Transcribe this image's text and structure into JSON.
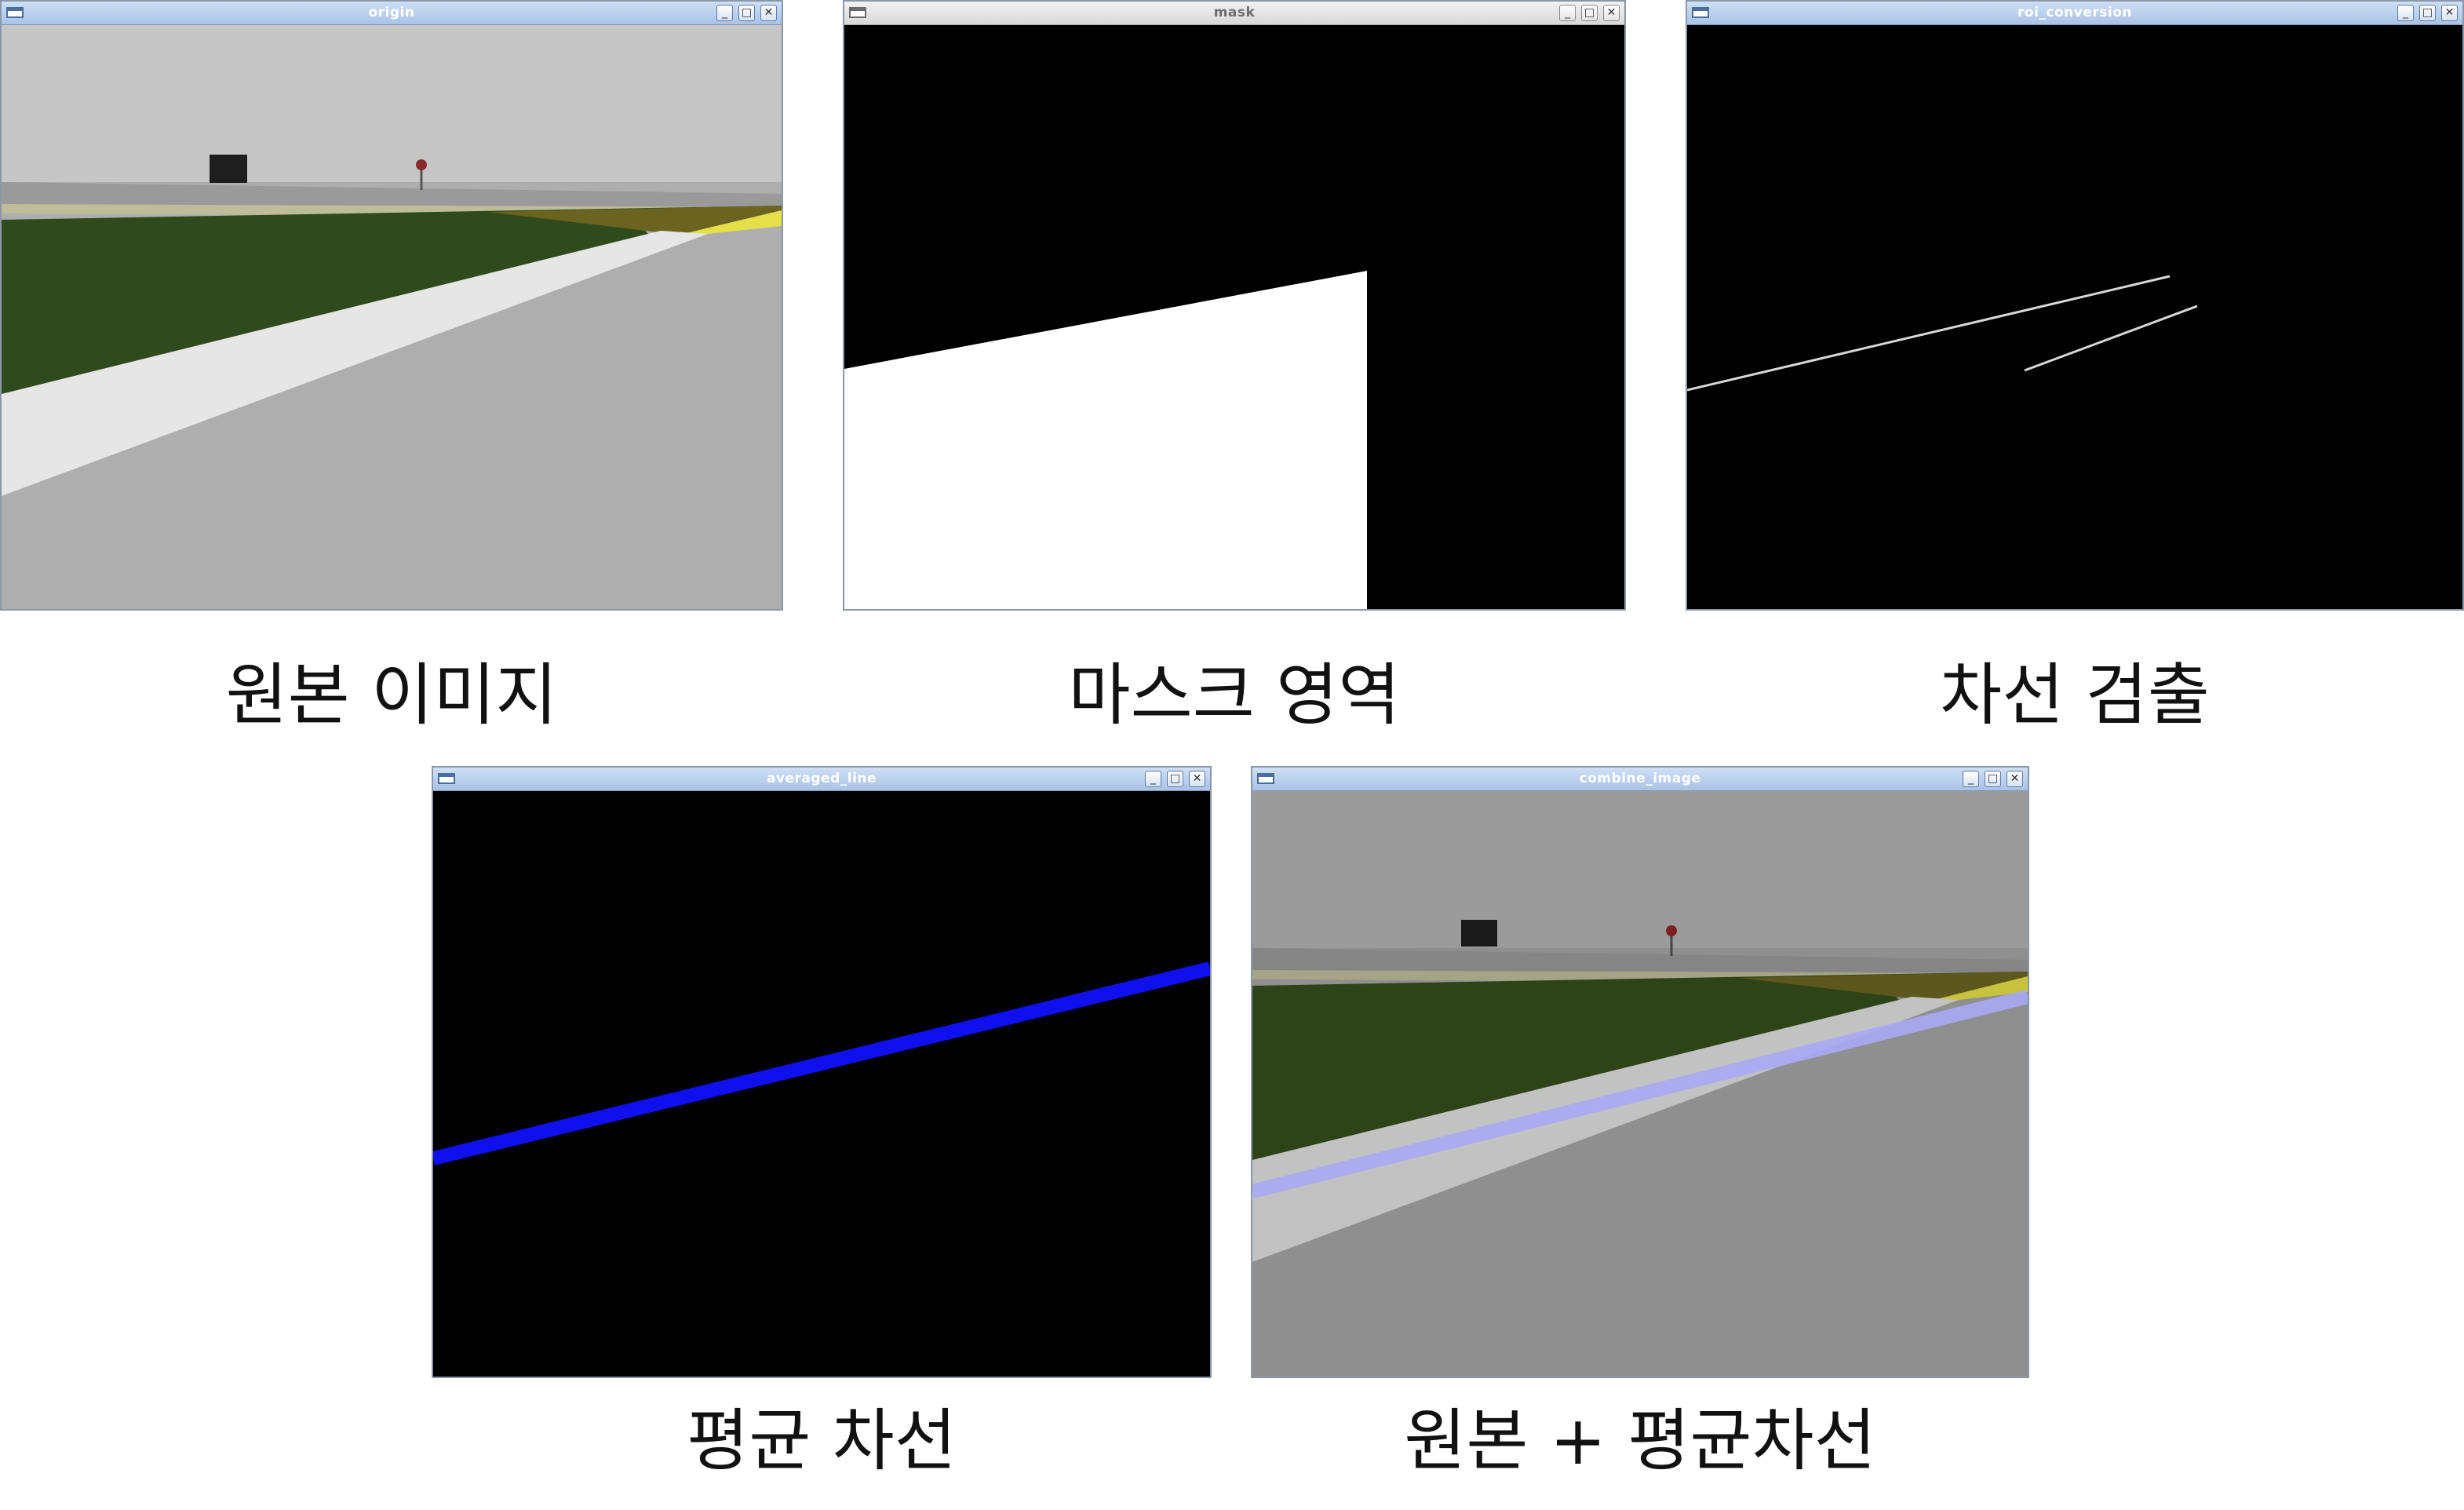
{
  "windows": {
    "origin": {
      "title": "origin"
    },
    "mask": {
      "title": "mask"
    },
    "roi": {
      "title": "roi_conversion"
    },
    "averaged": {
      "title": "averaged_line"
    },
    "combine": {
      "title": "combine_image"
    }
  },
  "window_controls": {
    "minimize": "minimize-icon",
    "maximize": "maximize-icon",
    "close": "close-icon"
  },
  "captions": {
    "origin": "원본 이미지",
    "mask": "마스크 영역",
    "lane": "차선 검출",
    "averaged": "평균 차선",
    "combine": "원본 + 평균차선"
  },
  "colors": {
    "sky": "#c3c3c3",
    "road": "#aeaeae",
    "grass": "#2f4a1c",
    "lane_white": "#e6e6e6",
    "yellow_line": "#d9d21a",
    "avg_line_blue": "#1010ee",
    "overlay_blue": "#a9a9f5",
    "mask_white": "#ffffff",
    "background": "#000000"
  }
}
